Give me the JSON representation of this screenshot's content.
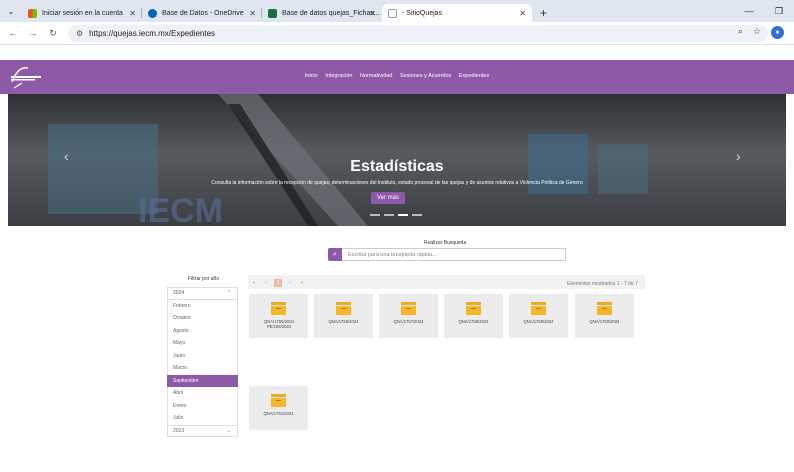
{
  "browser": {
    "tabs": [
      {
        "label": "Iniciar sesión en la cuenta",
        "icon": "microsoft-icon",
        "color": "#f25022"
      },
      {
        "label": "Base de Datos - OneDrive",
        "icon": "onedrive-icon",
        "color": "#0364b8"
      },
      {
        "label": "Base de datos quejas_Fichas...",
        "icon": "excel-icon",
        "color": "#1d6f42"
      },
      {
        "label": "- SitioQuejas",
        "icon": "page-icon",
        "color": "#9aa0a6"
      }
    ],
    "url": "https://quejas.iecm.mx/Expedientes"
  },
  "site": {
    "nav": [
      "Inicio",
      "Integración",
      "Normatividad",
      "Sesiones y Acuerdos",
      "Expedientes"
    ],
    "accent": "#8e5aa8"
  },
  "hero": {
    "title": "Estadísticas",
    "description": "Consulta la información sobre la recepción de quejas, determinaciones del Instituto, estado procesal de las quejas y de asuntos relativos a Violencia Política de Género",
    "button": "Ver más"
  },
  "search": {
    "label": "Realizar Busqueda",
    "placeholder": "Escriba para una busqueda rápida..."
  },
  "filter": {
    "title": "Filtrar por año",
    "year": "2024",
    "months": [
      "Febrero",
      "Octubre",
      "Agosto",
      "Mayo",
      "Junio",
      "Marzo",
      "Septiembre",
      "Abril",
      "Enero",
      "Julio"
    ],
    "selected": "Septiembre",
    "next_year": "2023"
  },
  "pager": {
    "current": "1",
    "info": "Elementos mostrados 1 - 7 de 7"
  },
  "cards": [
    {
      "name": "QNA/1755/2024 PE/193/2024"
    },
    {
      "name": "QNA/1756/2024"
    },
    {
      "name": "QNA/1757/2024"
    },
    {
      "name": "QNA/1758/2024"
    },
    {
      "name": "QNA/1759/2024"
    },
    {
      "name": "QNA/1760/2024"
    },
    {
      "name": "QNA/1761/2024"
    }
  ]
}
